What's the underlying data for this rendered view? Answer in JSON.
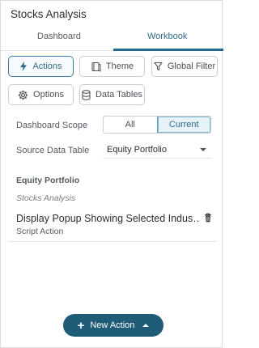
{
  "panel": {
    "title": "Stocks Analysis"
  },
  "tabs": [
    {
      "label": "Dashboard",
      "active": false
    },
    {
      "label": "Workbook",
      "active": true
    }
  ],
  "toolbar": {
    "actions": "Actions",
    "theme": "Theme",
    "global_filter": "Global Filter",
    "options": "Options",
    "data_tables": "Data Tables"
  },
  "scope": {
    "label": "Dashboard Scope",
    "options": [
      "All",
      "Current"
    ],
    "selected": "Current"
  },
  "source": {
    "label": "Source Data Table",
    "value": "Equity Portfolio"
  },
  "section": {
    "title": "Equity Portfolio",
    "subtitle": "Stocks Analysis"
  },
  "action_item": {
    "name": "Display Popup Showing Selected Indus…",
    "type": "Script Action"
  },
  "new_action": {
    "label": "New Action"
  },
  "colors": {
    "accent": "#1e5c78",
    "tab_active": "#1f6e8f",
    "selected_bg": "#e7f3f8"
  }
}
